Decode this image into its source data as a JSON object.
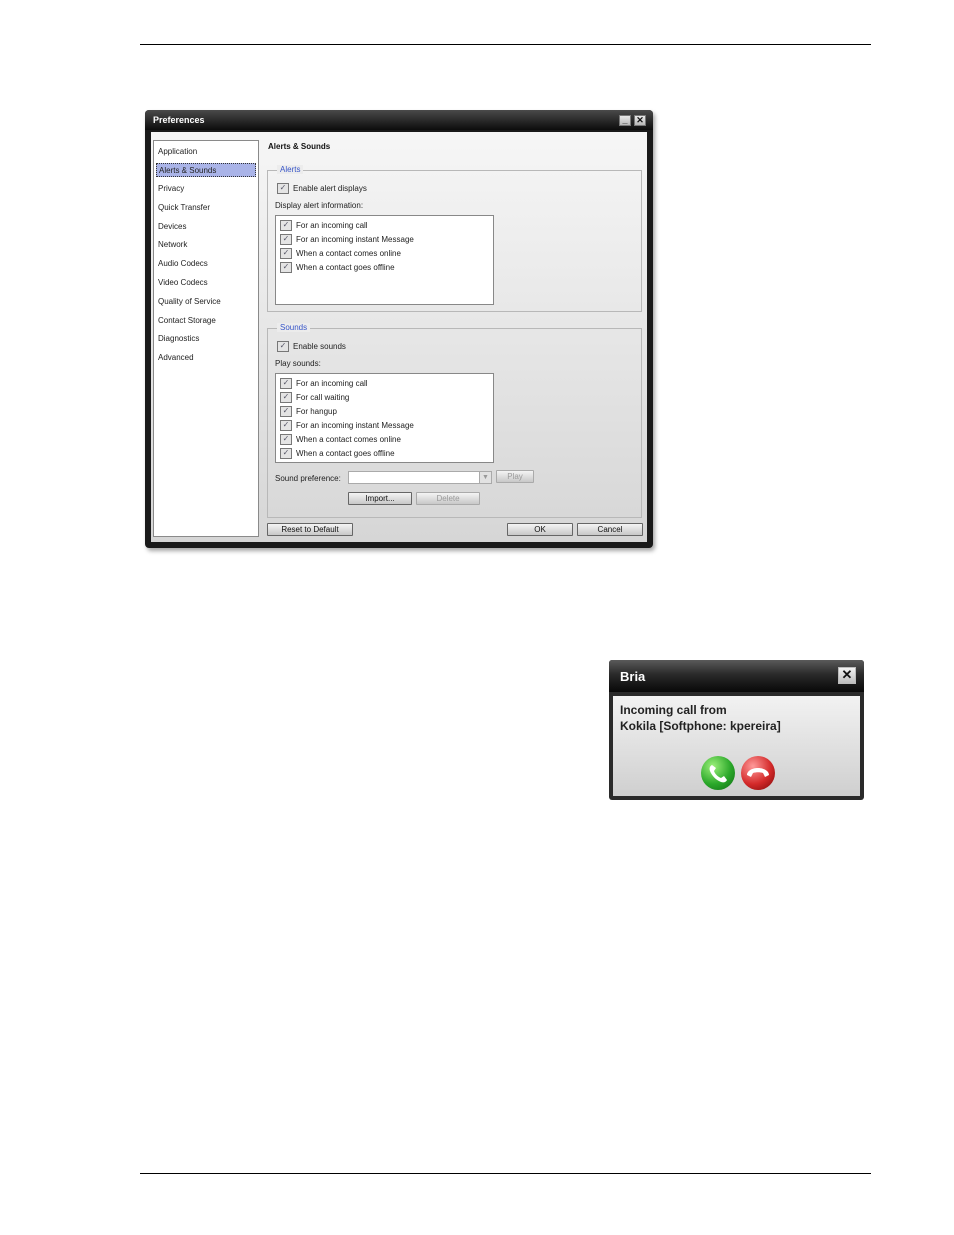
{
  "preferences_window": {
    "title": "Preferences",
    "nav_items": [
      {
        "label": "Application",
        "selected": false
      },
      {
        "label": "Alerts & Sounds",
        "selected": true
      },
      {
        "label": "Privacy",
        "selected": false
      },
      {
        "label": "Quick Transfer",
        "selected": false
      },
      {
        "label": "Devices",
        "selected": false
      },
      {
        "label": "Network",
        "selected": false
      },
      {
        "label": "Audio Codecs",
        "selected": false
      },
      {
        "label": "Video Codecs",
        "selected": false
      },
      {
        "label": "Quality of Service",
        "selected": false
      },
      {
        "label": "Contact Storage",
        "selected": false
      },
      {
        "label": "Diagnostics",
        "selected": false
      },
      {
        "label": "Advanced",
        "selected": false
      }
    ],
    "pane_title": "Alerts & Sounds",
    "alerts": {
      "legend": "Alerts",
      "enable_label": "Enable alert displays",
      "enable_checked": true,
      "list_label": "Display alert information:",
      "items": [
        {
          "label": "For an incoming call",
          "checked": true
        },
        {
          "label": "For an incoming instant Message",
          "checked": true
        },
        {
          "label": "When a contact comes online",
          "checked": true
        },
        {
          "label": "When a contact goes offline",
          "checked": true
        }
      ]
    },
    "sounds": {
      "legend": "Sounds",
      "enable_label": "Enable sounds",
      "enable_checked": true,
      "list_label": "Play sounds:",
      "items": [
        {
          "label": "For an incoming call",
          "checked": true
        },
        {
          "label": "For call waiting",
          "checked": true
        },
        {
          "label": "For hangup",
          "checked": true
        },
        {
          "label": "For an incoming instant Message",
          "checked": true
        },
        {
          "label": "When a contact comes online",
          "checked": true
        },
        {
          "label": "When a contact goes offline",
          "checked": true
        }
      ],
      "preference_label": "Sound preference:",
      "preference_value": "",
      "play_label": "Play",
      "import_label": "Import...",
      "delete_label": "Delete"
    },
    "buttons": {
      "reset": "Reset to Default",
      "ok": "OK",
      "cancel": "Cancel"
    }
  },
  "bria_popup": {
    "title": "Bria",
    "line1": "Incoming call from",
    "line2": "Kokila [Softphone: kpereira]",
    "answer_icon": "phone-answer-icon",
    "hangup_icon": "phone-hangup-icon"
  }
}
